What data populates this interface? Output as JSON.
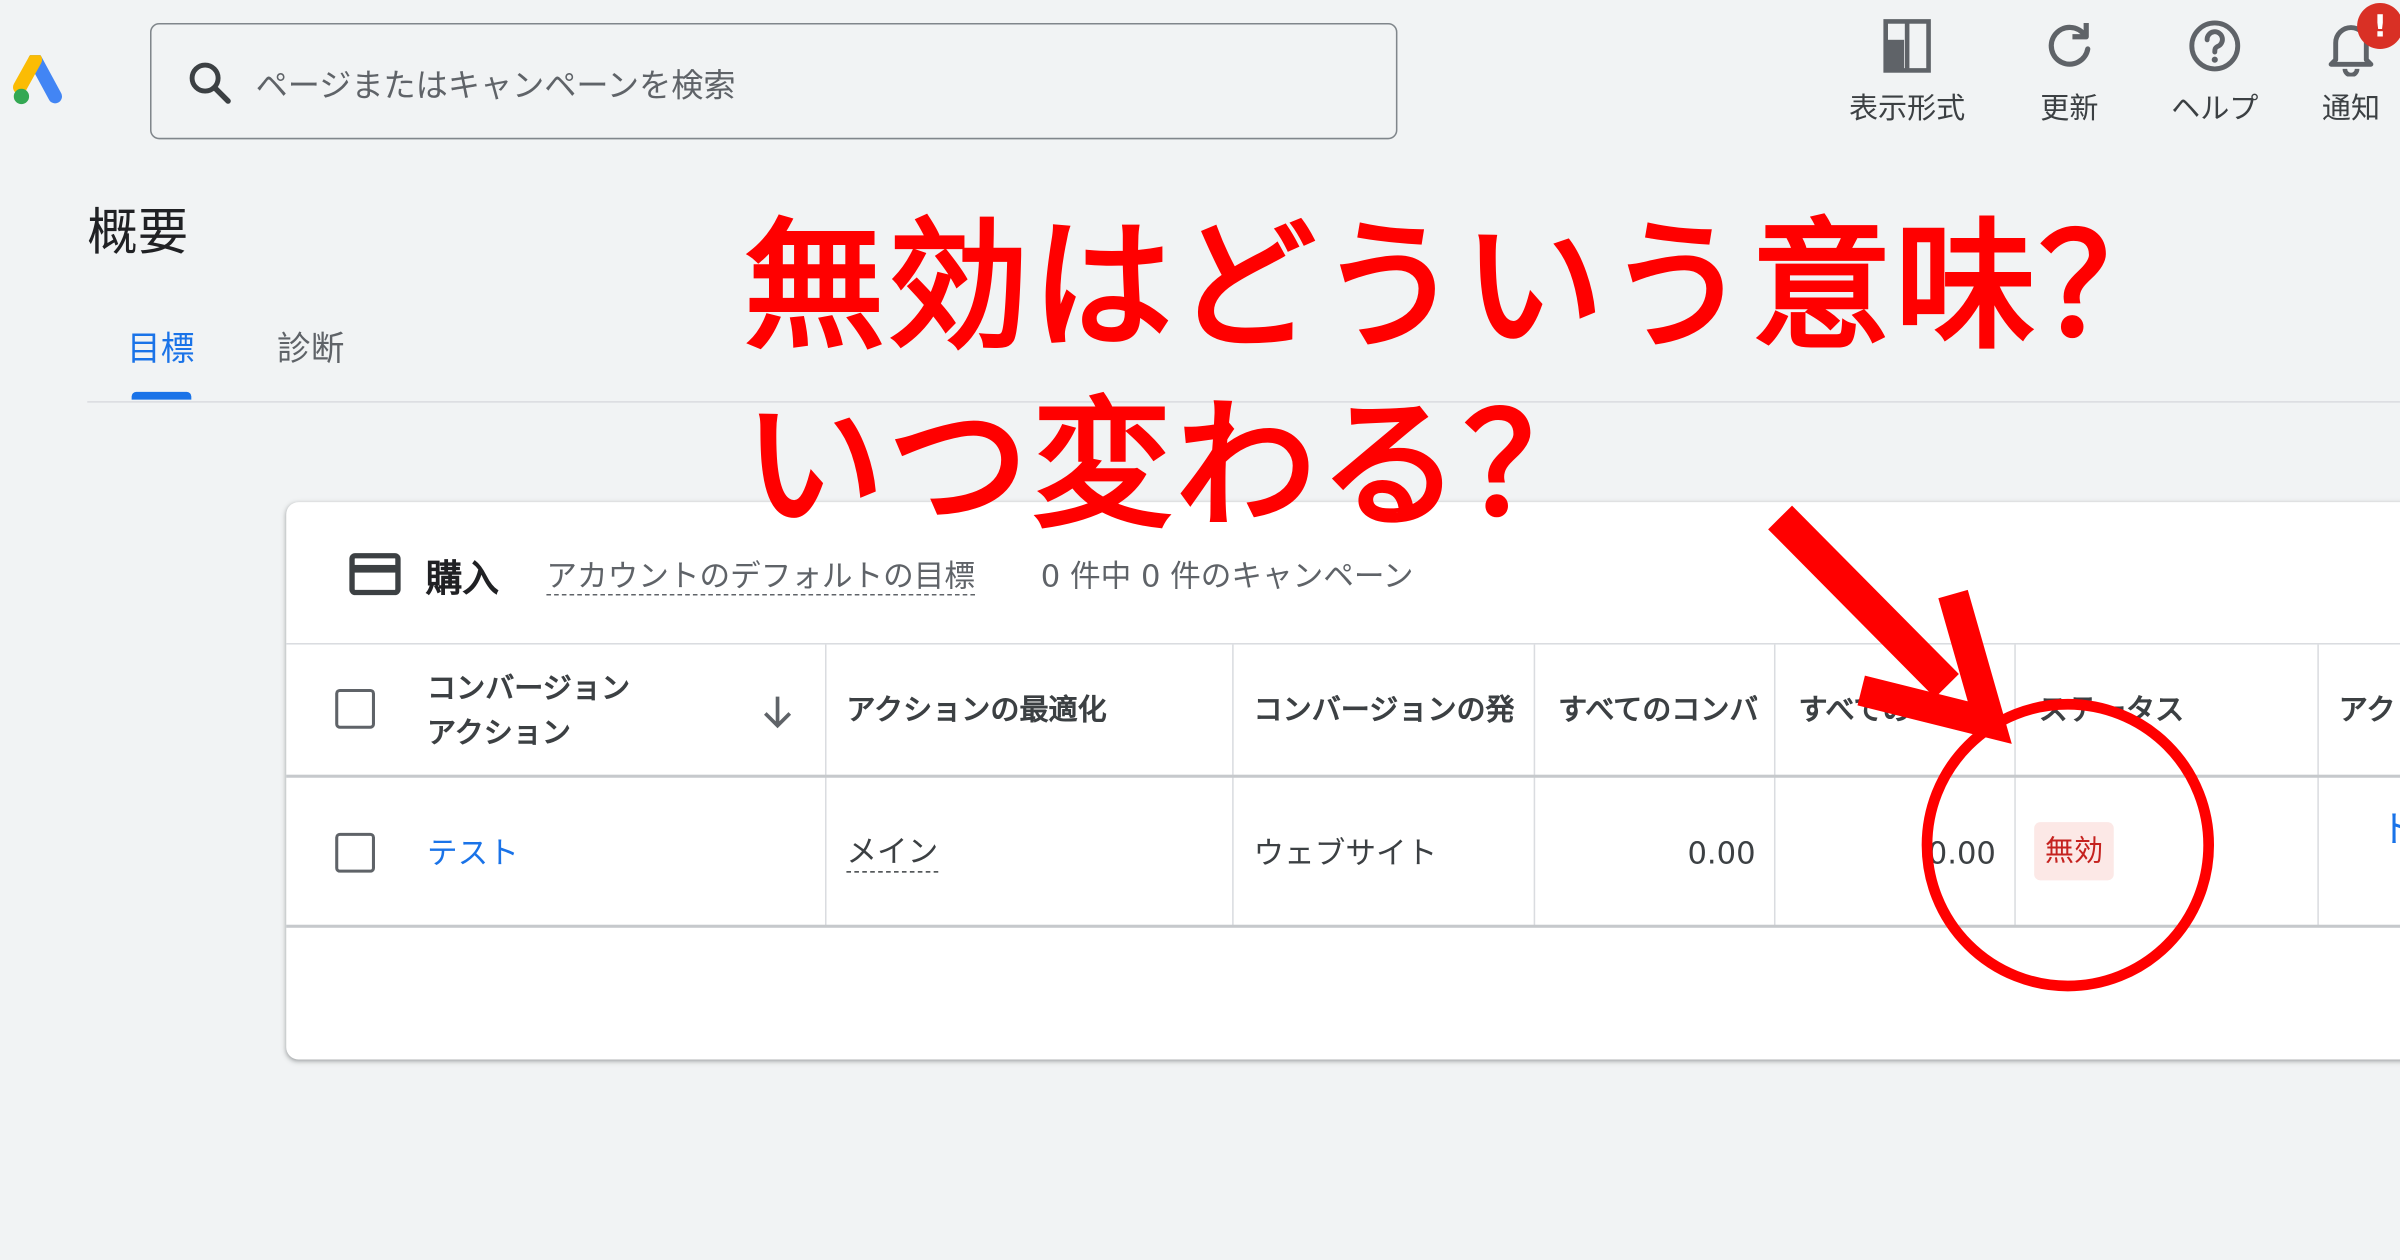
{
  "header": {
    "search_placeholder": "ページまたはキャンペーンを検索",
    "tools": [
      {
        "label": "表示形式",
        "icon": "appearance-icon"
      },
      {
        "label": "更新",
        "icon": "refresh-icon"
      },
      {
        "label": "ヘルプ",
        "icon": "help-icon"
      },
      {
        "label": "通知",
        "icon": "bell-icon"
      }
    ],
    "notification_badge": "!"
  },
  "page": {
    "title": "概要",
    "tabs": [
      {
        "label": "目標",
        "active": true
      },
      {
        "label": "診断",
        "active": false
      }
    ]
  },
  "card": {
    "title": "購入",
    "subtitle_link": "アカウントのデフォルトの目標",
    "campaign_count": "0 件中 0 件のキャンペーン",
    "columns": [
      {
        "label": "コンバージョン\nアクション",
        "line1": "コンバージョン",
        "line2": "アクション",
        "sort": "down"
      },
      {
        "label": "アクションの最適化"
      },
      {
        "label": "コンバージョンの発"
      },
      {
        "label": "すべてのコンバ"
      },
      {
        "label": "すべてのコンバ"
      },
      {
        "label": "ステータス"
      },
      {
        "label": "アク"
      }
    ],
    "rows": [
      {
        "action": "テスト",
        "optimization": "メイン",
        "source": "ウェブサイト",
        "all_conv_1": "0.00",
        "all_conv_2": "0.00",
        "status": "無効",
        "action_col": "ト"
      }
    ]
  },
  "annotation": {
    "line1": "無効はどういう意味？",
    "line2": "いつ変わる？",
    "color": "#ff0000"
  },
  "colors": {
    "accent": "#1a73e8",
    "background": "#f1f3f4",
    "status_bg": "#fce8e6",
    "status_text": "#c5221f"
  }
}
